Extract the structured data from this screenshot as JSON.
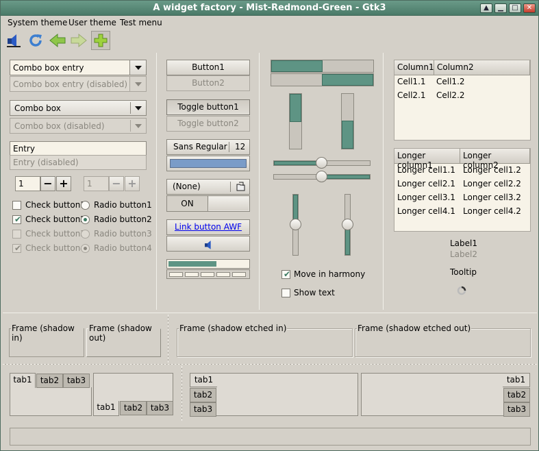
{
  "window": {
    "title": "A widget factory - Mist-Redmond-Green - Gtk3"
  },
  "menubar": {
    "items": [
      "System theme",
      "User theme",
      "Test menu"
    ]
  },
  "toolbar": {
    "icons": [
      "audio-volume-icon",
      "refresh-icon",
      "back-arrow-icon",
      "forward-arrow-icon",
      "add-icon"
    ]
  },
  "col1": {
    "combo_entry": "Combo box entry",
    "combo_entry_disabled": "Combo box entry (disabled)",
    "combo": "Combo box",
    "combo_disabled": "Combo box (disabled)",
    "entry": "Entry",
    "entry_disabled": "Entry (disabled)",
    "spin_value": "1",
    "spin_disabled_value": "1",
    "checks": [
      {
        "label": "Check button1",
        "checked": false,
        "disabled": false
      },
      {
        "label": "Check button2",
        "checked": true,
        "disabled": false
      },
      {
        "label": "Check button3",
        "checked": false,
        "disabled": true
      },
      {
        "label": "Check button4",
        "checked": true,
        "disabled": true
      }
    ],
    "radios": [
      {
        "label": "Radio button1",
        "selected": false,
        "disabled": false
      },
      {
        "label": "Radio button2",
        "selected": true,
        "disabled": false
      },
      {
        "label": "Radio button3",
        "selected": false,
        "disabled": true
      },
      {
        "label": "Radio button4",
        "selected": true,
        "disabled": true
      }
    ]
  },
  "col2": {
    "button1": "Button1",
    "button2": "Button2",
    "toggle1": "Toggle button1",
    "toggle2": "Toggle button2",
    "font_name": "Sans Regular",
    "font_size": "12",
    "color_swatch": "#7a9cc8",
    "file_chooser": "(None)",
    "switch_label": "ON",
    "link_button": "Link button AWF",
    "progress_fraction": 0.6
  },
  "col3": {
    "hprogress": [
      0.5,
      0.5
    ],
    "vprogress": [
      0.5,
      0.5
    ],
    "hscale": [
      0.5,
      0.5
    ],
    "vscale": [
      0.5,
      0.5
    ],
    "move_in_harmony": "Move in harmony",
    "move_in_harmony_checked": true,
    "show_text": "Show text",
    "show_text_checked": false
  },
  "col4": {
    "tree1": {
      "columns": [
        "Column1",
        "Column2"
      ],
      "rows": [
        [
          "Cell1.1",
          "Cell1.2"
        ],
        [
          "Cell2.1",
          "Cell2.2"
        ]
      ]
    },
    "tree2": {
      "columns": [
        "Longer column1",
        "Longer column2"
      ],
      "rows": [
        [
          "Longer cell1.1",
          "Longer cell1.2"
        ],
        [
          "Longer cell2.1",
          "Longer cell2.2"
        ],
        [
          "Longer cell3.1",
          "Longer cell3.2"
        ],
        [
          "Longer cell4.1",
          "Longer cell4.2"
        ]
      ]
    },
    "label1": "Label1",
    "label2": "Label2",
    "tooltip": "Tooltip"
  },
  "frames": [
    "Frame (shadow in)",
    "Frame (shadow out)",
    "Frame (shadow etched in)",
    "Frame (shadow etched out)"
  ],
  "notebooks": {
    "tabs": [
      "tab1",
      "tab2",
      "tab3"
    ]
  },
  "colors": {
    "accent": "#5e9484",
    "titlebar": "#5a8a78",
    "link": "#0000ee"
  }
}
